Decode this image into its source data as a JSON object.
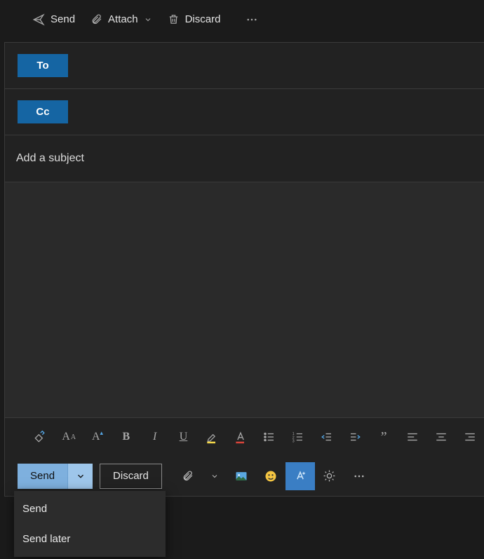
{
  "toolbar": {
    "send_label": "Send",
    "attach_label": "Attach",
    "discard_label": "Discard"
  },
  "compose": {
    "to_label": "To",
    "cc_label": "Cc",
    "subject_placeholder": "Add a subject"
  },
  "actions": {
    "send_label": "Send",
    "discard_label": "Discard"
  },
  "send_menu": {
    "items": [
      "Send",
      "Send later"
    ]
  },
  "colors": {
    "accent": "#1565a3",
    "send_btn": "#7eb0de",
    "send_caret": "#9ec6ea",
    "ai_active": "#3a7ec4"
  }
}
